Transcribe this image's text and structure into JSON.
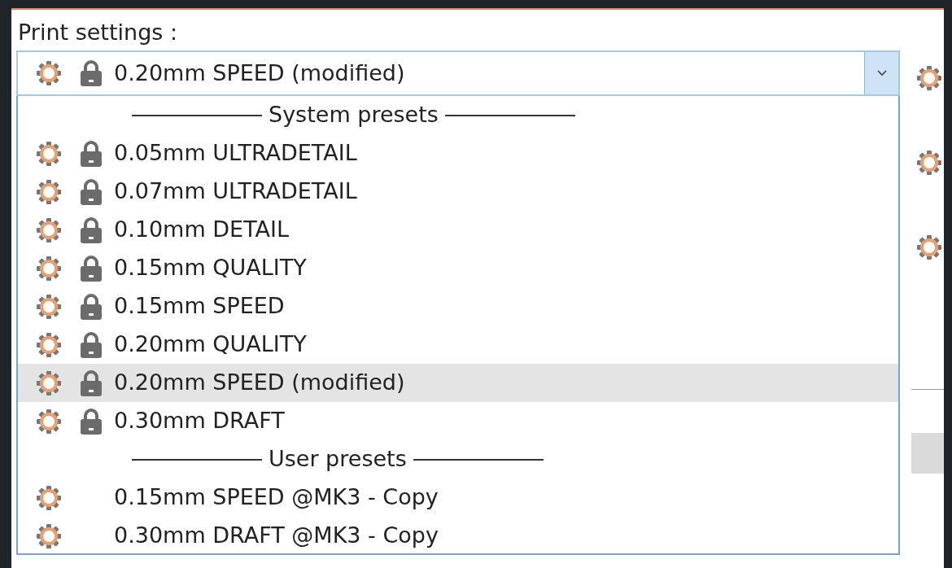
{
  "label": "Print settings :",
  "combo": {
    "value": "0.20mm SPEED (modified)",
    "locked": true,
    "expanded": true
  },
  "list": [
    {
      "kind": "header",
      "text": "System presets"
    },
    {
      "kind": "preset",
      "text": "0.05mm ULTRADETAIL",
      "locked": true,
      "selected": false
    },
    {
      "kind": "preset",
      "text": "0.07mm ULTRADETAIL",
      "locked": true,
      "selected": false
    },
    {
      "kind": "preset",
      "text": "0.10mm DETAIL",
      "locked": true,
      "selected": false
    },
    {
      "kind": "preset",
      "text": "0.15mm QUALITY",
      "locked": true,
      "selected": false
    },
    {
      "kind": "preset",
      "text": "0.15mm SPEED",
      "locked": true,
      "selected": false
    },
    {
      "kind": "preset",
      "text": "0.20mm QUALITY",
      "locked": true,
      "selected": false
    },
    {
      "kind": "preset",
      "text": "0.20mm SPEED (modified)",
      "locked": true,
      "selected": true
    },
    {
      "kind": "preset",
      "text": "0.30mm DRAFT",
      "locked": true,
      "selected": false
    },
    {
      "kind": "header",
      "text": "User presets"
    },
    {
      "kind": "preset",
      "text": "0.15mm SPEED @MK3 - Copy",
      "locked": false,
      "selected": false
    },
    {
      "kind": "preset",
      "text": "0.30mm DRAFT @MK3 - Copy",
      "locked": false,
      "selected": false
    }
  ]
}
